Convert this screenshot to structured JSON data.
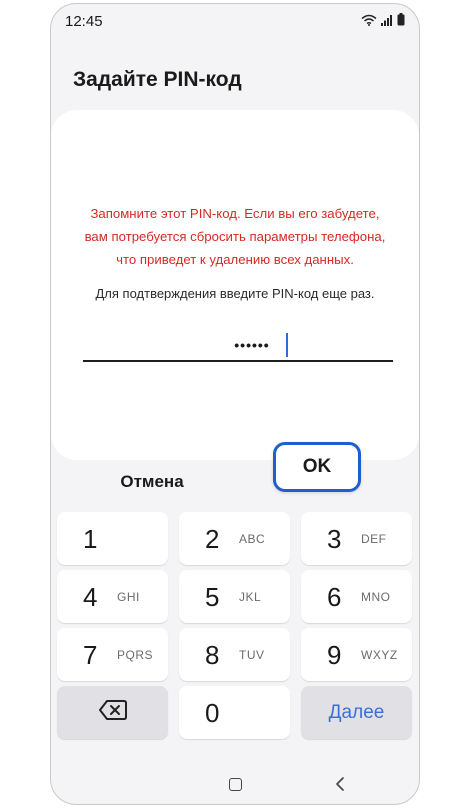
{
  "status_bar": {
    "time": "12:45",
    "icons": [
      "wifi-icon",
      "cellular-signal-icon",
      "battery-icon"
    ]
  },
  "page": {
    "title": "Задайте PIN-код"
  },
  "dialog": {
    "warning_lines": [
      "Запомните этот PIN-код. Если вы его забудете,",
      "вам потребуется сбросить параметры телефона,",
      "что приведет к удалению всех данных."
    ],
    "instruction": "Для подтверждения введите PIN-код еще раз.",
    "pin_value": "••••••",
    "cancel_label": "Отмена",
    "ok_label": "OK"
  },
  "keypad": {
    "keys": [
      {
        "num": "1",
        "letters": ""
      },
      {
        "num": "2",
        "letters": "ABC"
      },
      {
        "num": "3",
        "letters": "DEF"
      },
      {
        "num": "4",
        "letters": "GHI"
      },
      {
        "num": "5",
        "letters": "JKL"
      },
      {
        "num": "6",
        "letters": "MNO"
      },
      {
        "num": "7",
        "letters": "PQRS"
      },
      {
        "num": "8",
        "letters": "TUV"
      },
      {
        "num": "9",
        "letters": "WXYZ"
      }
    ],
    "zero": "0",
    "next_label": "Далее",
    "backspace_icon": "backspace-icon"
  },
  "nav_bar": {
    "icons": [
      "home-icon",
      "back-icon"
    ]
  },
  "colors": {
    "warning_text": "#d42a22",
    "accent_blue": "#1d5fcf",
    "next_text": "#3b6fd6",
    "screen_bg": "#f4f4f6"
  }
}
